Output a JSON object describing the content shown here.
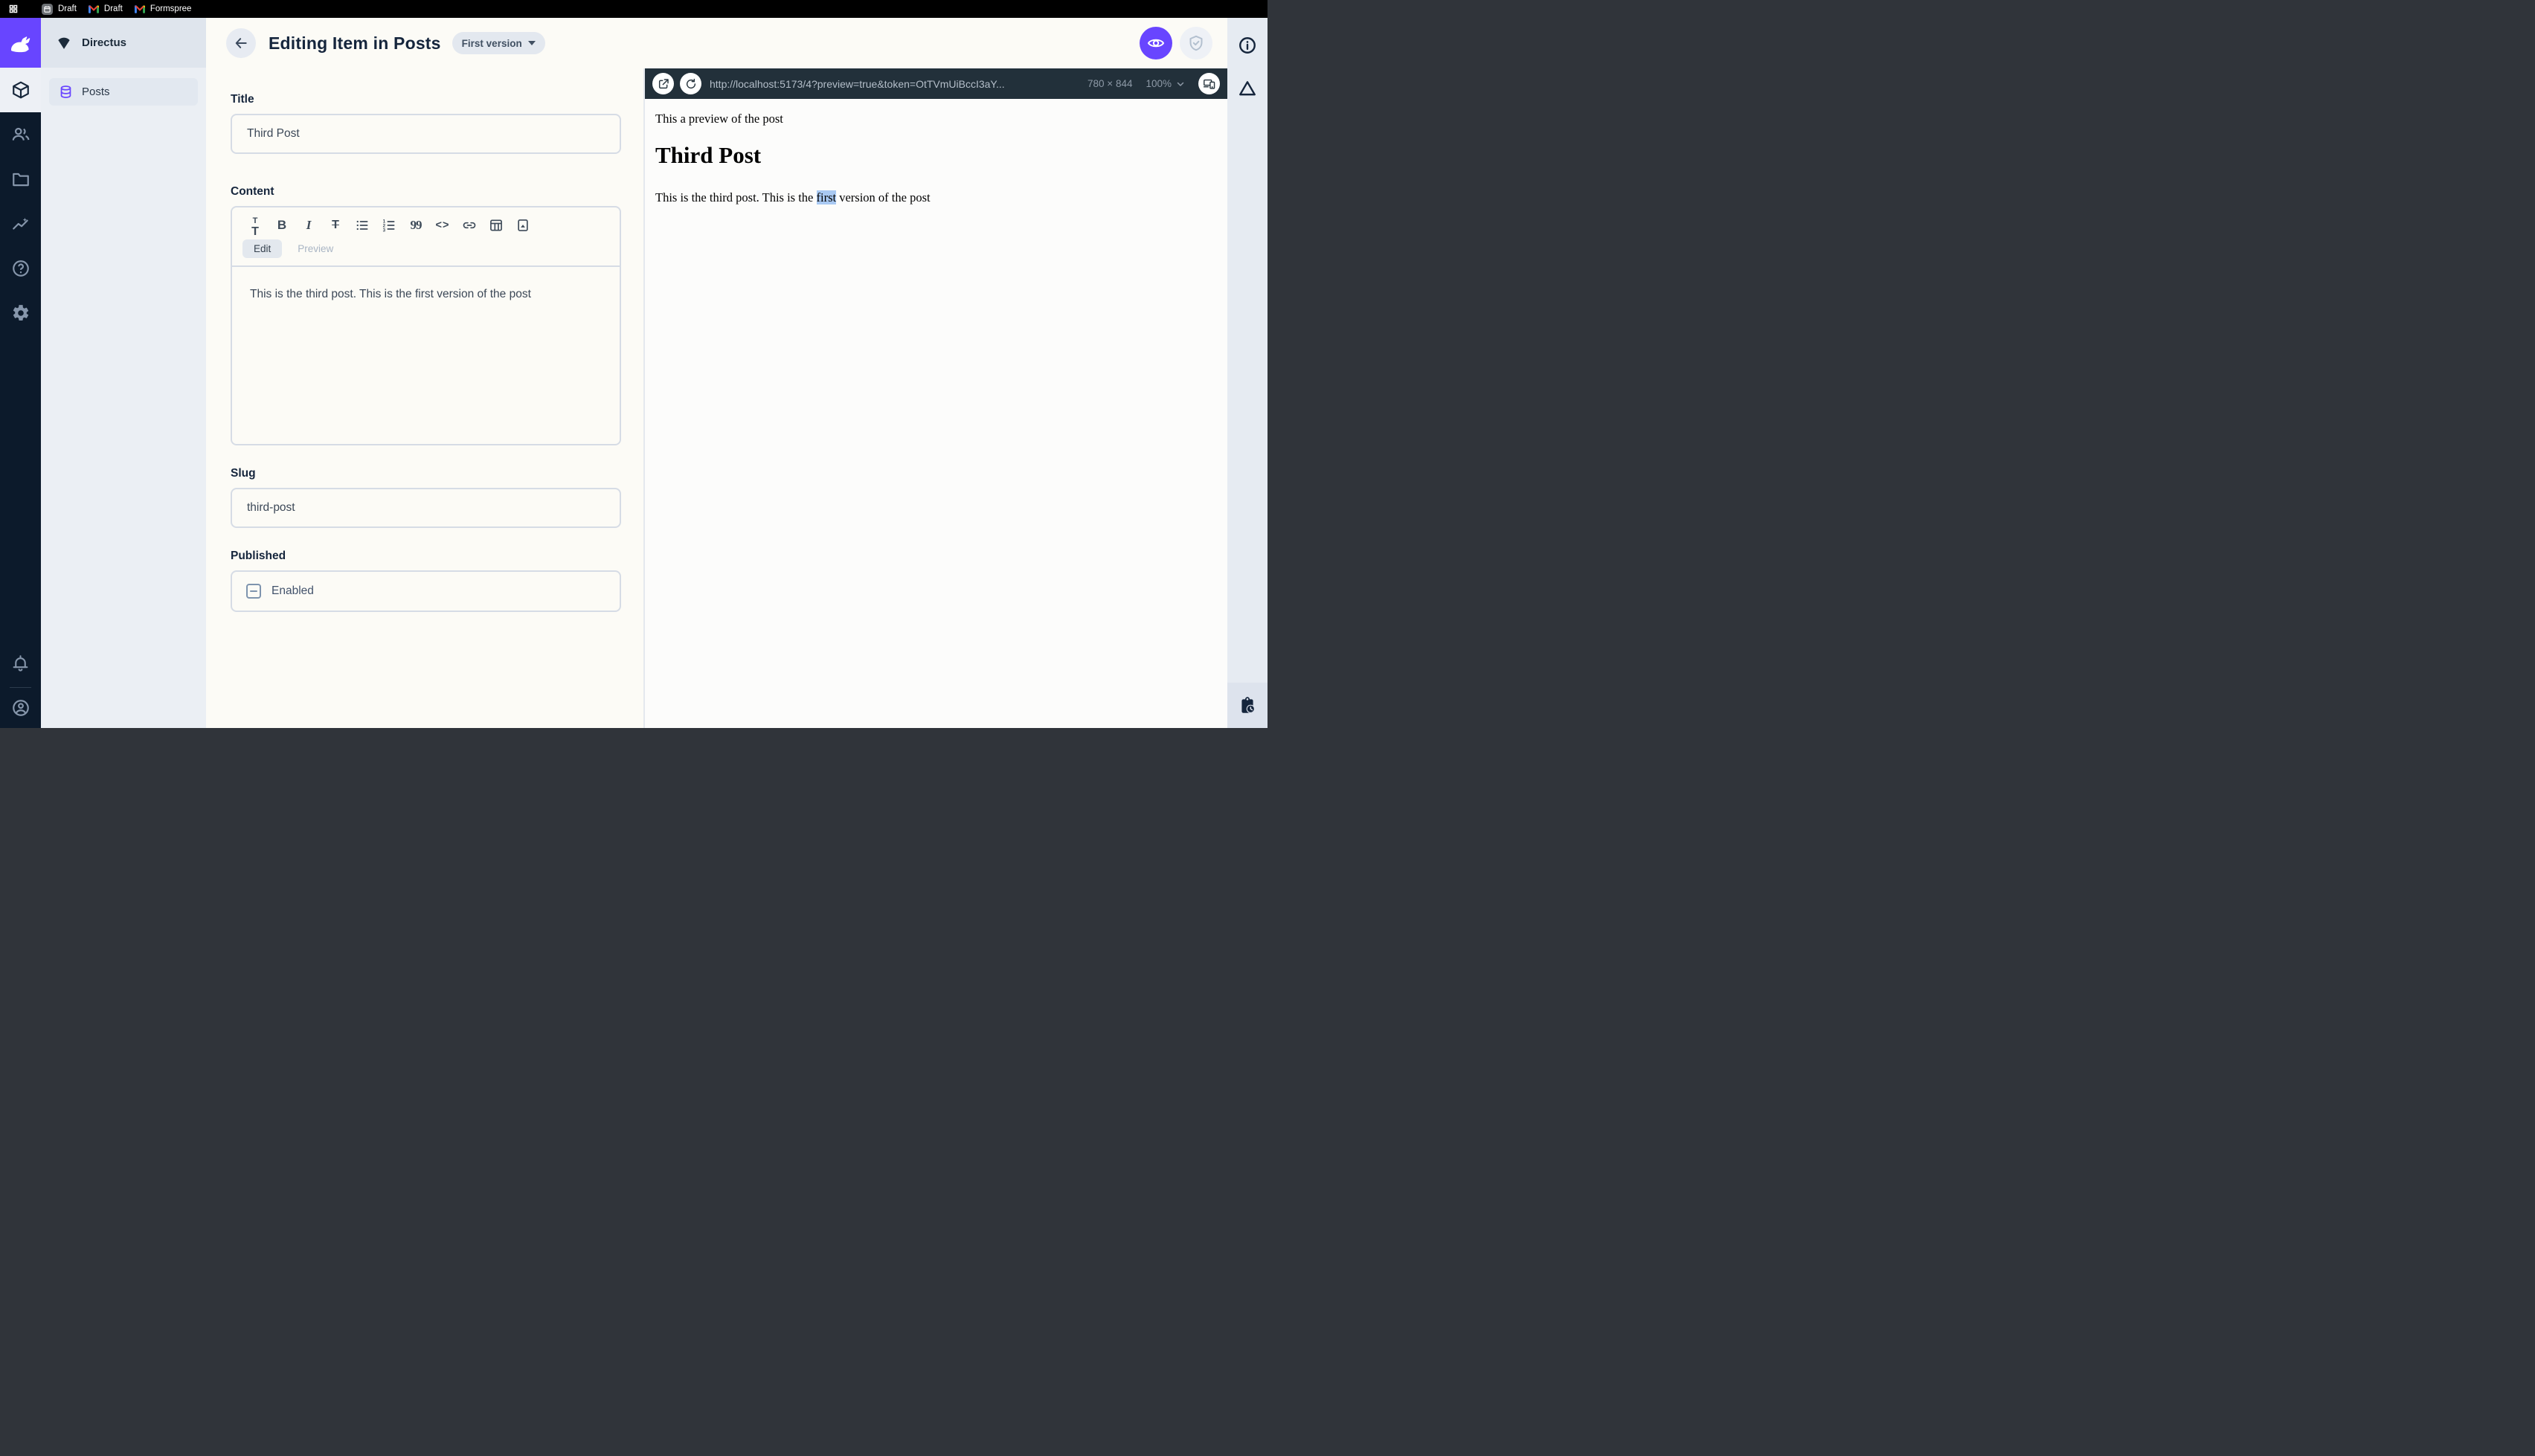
{
  "topbar": {
    "tabs": [
      {
        "label": "Draft",
        "icon": "calendar-icon"
      },
      {
        "label": "Draft",
        "icon": "gmail-icon"
      },
      {
        "label": "Formspree",
        "icon": "gmail-icon"
      }
    ],
    "launcher_icon": "grid-icon"
  },
  "sidebar": {
    "project_name": "Directus",
    "project_icon": "fan-wedge-icon",
    "logo_icon": "directus-rabbit-logo",
    "module_icons": [
      "box-icon",
      "users-icon",
      "folder-icon",
      "insights-icon",
      "help-icon",
      "settings-icon",
      "bell-icon",
      "user-circle-icon"
    ],
    "active_module": "content",
    "nav_items": [
      {
        "label": "Posts",
        "icon": "database-icon",
        "active": true
      }
    ]
  },
  "header": {
    "title": "Editing Item in Posts",
    "version_chip": "First version",
    "action_icons": [
      "eye-icon",
      "shield-check-icon"
    ]
  },
  "form": {
    "title": {
      "label": "Title",
      "value": "Third Post"
    },
    "content": {
      "label": "Content",
      "toolbar_icons": [
        "format-size-icon",
        "bold-icon",
        "italic-icon",
        "strikethrough-icon",
        "bulleted-list-icon",
        "numbered-list-icon",
        "blockquote-icon",
        "code-icon",
        "link-icon",
        "table-icon",
        "image-icon"
      ],
      "tabs": [
        "Edit",
        "Preview"
      ],
      "active_tab": "Edit",
      "value": "This is the third post. This is the first version of the post"
    },
    "slug": {
      "label": "Slug",
      "value": "third-post"
    },
    "published": {
      "label": "Published",
      "checkbox_label": "Enabled",
      "checkbox_state": "indeterminate"
    }
  },
  "preview": {
    "url": "http://localhost:5173/4?preview=true&token=OtTVmUiBccI3aY...",
    "toolbar_icons": [
      "external-link-icon",
      "refresh-icon",
      "devices-icon"
    ],
    "dimensions": "780 × 844",
    "zoom": "100%",
    "content": {
      "intro": "This a preview of the post",
      "heading": "Third Post",
      "body_before": "This is the third post. This is the ",
      "body_highlight": "first",
      "body_after": " version of the post"
    }
  },
  "rightbar": {
    "icons": [
      "info-icon",
      "warning-triangle-icon",
      "clipboard-clock-icon"
    ]
  },
  "colors": {
    "accent": "#6845ff",
    "topbar_bg": "#000000",
    "module_bar_bg": "#0c1a2b",
    "url_bar_bg": "#22303a",
    "selection_highlight": "#a9c9f2"
  }
}
